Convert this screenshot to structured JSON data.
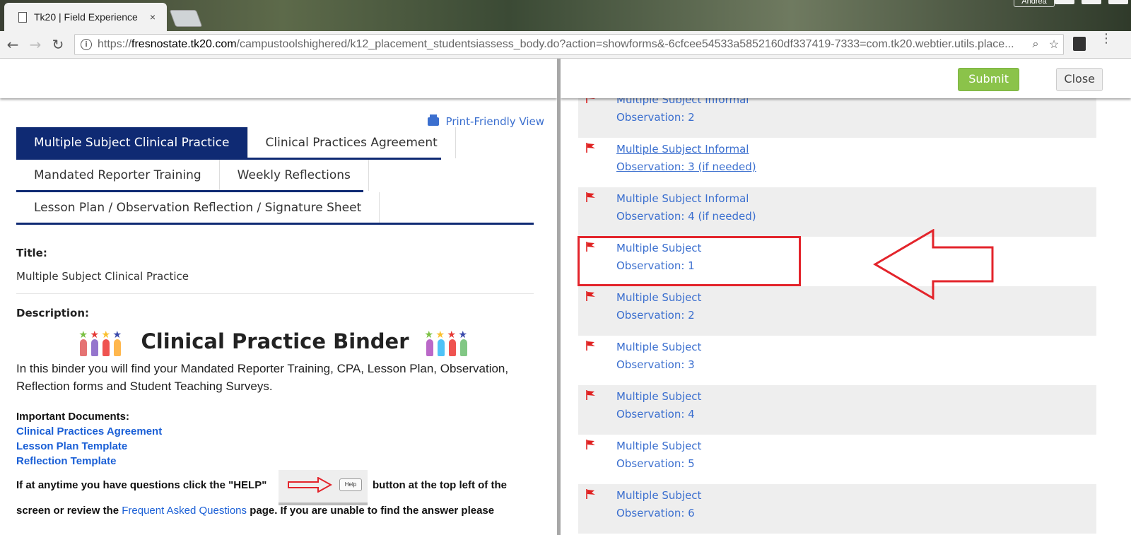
{
  "browser": {
    "tab_title": "Tk20 | Field Experience",
    "tab_close": "×",
    "profile_name": "Andrea",
    "url_domain": "fresnostate.tk20.com",
    "url_prefix": "https://",
    "url_path": "/campustoolshighered/k12_placement_studentsiassess_body.do?action=showforms&-6cfcee54533a5852160df337419-7333=com.tk20.webtier.utils.place..."
  },
  "header": {
    "submit_label": "Submit",
    "close_label": "Close"
  },
  "left": {
    "print_label": "Print-Friendly View",
    "tab_rows": [
      [
        "Multiple Subject Clinical Practice",
        "Clinical Practices Agreement"
      ],
      [
        "Mandated Reporter Training",
        "Weekly Reflections"
      ],
      [
        "Lesson Plan / Observation Reflection / Signature Sheet"
      ]
    ],
    "active_tab": "Multiple Subject Clinical Practice",
    "title_label": "Title:",
    "title_value": "Multiple Subject Clinical Practice",
    "description_label": "Description:",
    "binder_title": "Clinical Practice Binder",
    "intro_line1": "In this binder you will find your Mandated Reporter Training, CPA, Lesson Plan, Observation,",
    "intro_line2": "Reflection forms and Student Teaching Surveys.",
    "important_docs_label": "Important Documents:",
    "doc_links": [
      "Clinical Practices Agreement",
      "Lesson Plan Template",
      "Reflection Template"
    ],
    "help_text_before": "If at anytime you have questions click the \"HELP\"",
    "help_text_after": "button at the top left of the",
    "help_button_label": "Help",
    "faq_line_before": "screen or review the",
    "faq_link": "Frequent Asked Questions",
    "faq_line_after": "page. If you are unable to find the answer please"
  },
  "right": {
    "observations": [
      {
        "line1": "Multiple Subject Informal",
        "line2": "Observation: 2",
        "underlined": false
      },
      {
        "line1": "Multiple Subject Informal",
        "line2": "Observation: 3 (if needed)",
        "underlined": true
      },
      {
        "line1": "Multiple Subject Informal",
        "line2": "Observation: 4 (if needed)",
        "underlined": false
      },
      {
        "line1": "Multiple Subject",
        "line2": "Observation: 1",
        "underlined": false
      },
      {
        "line1": "Multiple Subject",
        "line2": "Observation: 2",
        "underlined": false
      },
      {
        "line1": "Multiple Subject",
        "line2": "Observation: 3",
        "underlined": false
      },
      {
        "line1": "Multiple Subject",
        "line2": "Observation: 4",
        "underlined": false
      },
      {
        "line1": "Multiple Subject",
        "line2": "Observation: 5",
        "underlined": false
      },
      {
        "line1": "Multiple Subject",
        "line2": "Observation: 6",
        "underlined": false
      }
    ]
  },
  "colors": {
    "tab_active": "#0f2a73",
    "link": "#3b6fcf",
    "submit": "#8bc34a",
    "highlight": "#e3242b",
    "flag": "#e02020"
  }
}
